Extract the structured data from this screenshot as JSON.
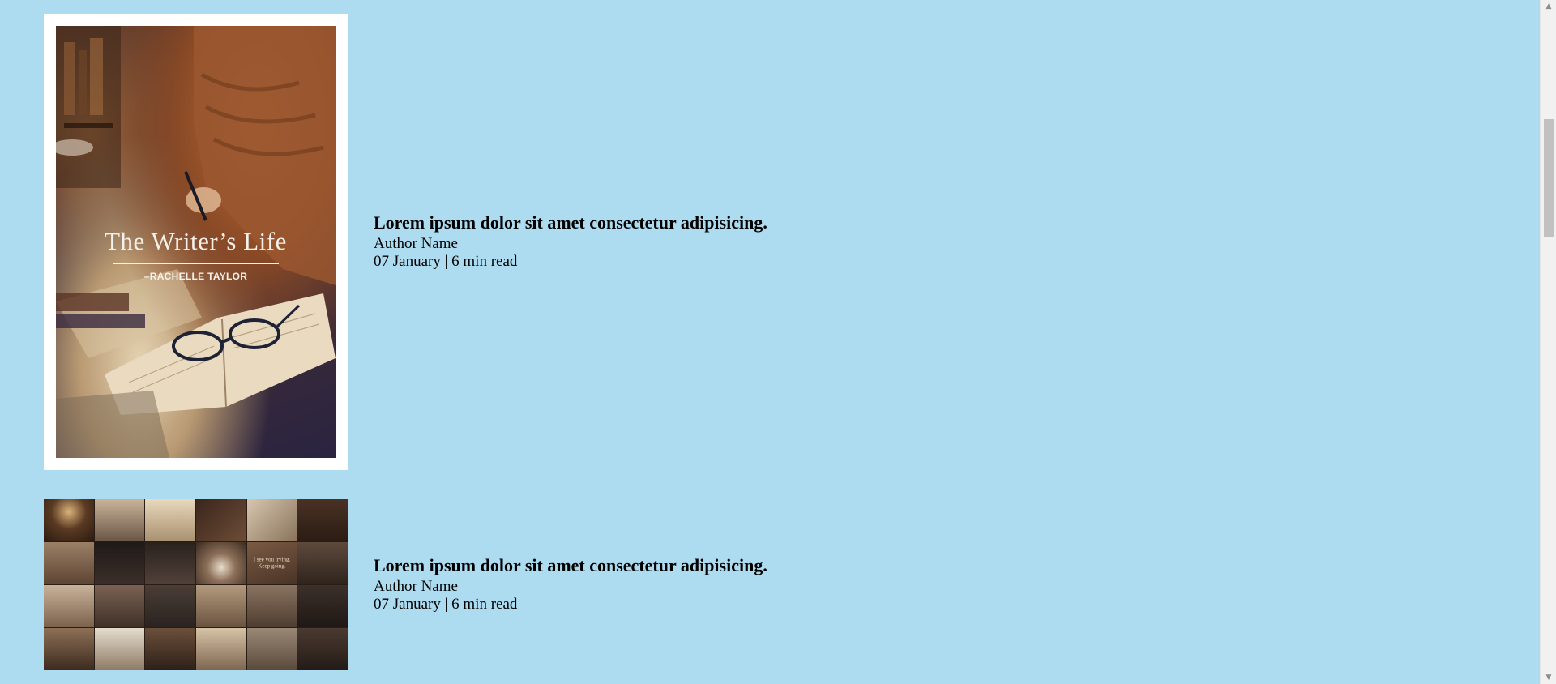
{
  "articles": [
    {
      "title": "Lorem ipsum dolor sit amet consectetur adipisicing.",
      "author": "Author Name",
      "meta": "07 January | 6 min read",
      "image": {
        "kind": "book-cover",
        "cover_title": "The Writer’s Life",
        "cover_author": "–RACHELLE TAYLOR"
      }
    },
    {
      "title": "Lorem ipsum dolor sit amet consectetur adipisicing.",
      "author": "Author Name",
      "meta": "07 January | 6 min read",
      "image": {
        "kind": "moodboard-collage",
        "tile_text": "I see you trying. Keep going."
      }
    }
  ],
  "colors": {
    "background": "#ADDCF1",
    "cover_frame": "#FFFFFF"
  },
  "icons": {
    "scroll_up": "triangle-up",
    "scroll_down": "triangle-down"
  }
}
